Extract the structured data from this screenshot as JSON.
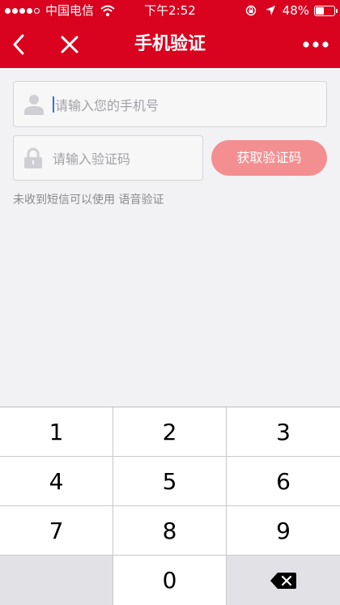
{
  "status_bar": {
    "carrier": "中国电信",
    "time": "下午2:52",
    "battery": "48%",
    "battery_level": 0.48
  },
  "nav": {
    "title": "手机验证",
    "back_icon": "chevron-left-icon",
    "close_icon": "close-icon",
    "more_icon": "more-dots-icon"
  },
  "form": {
    "phone_placeholder": "请输入您的手机号",
    "code_placeholder": "请输入验证码",
    "get_code_label": "获取验证码",
    "hint": "未收到短信可以使用 语音验证"
  },
  "keypad": {
    "keys": [
      "1",
      "2",
      "3",
      "4",
      "5",
      "6",
      "7",
      "8",
      "9",
      "",
      "0",
      "backspace"
    ]
  },
  "colors": {
    "header": "#d9021f",
    "button": "#f38f91",
    "background": "#f2f2f4"
  }
}
